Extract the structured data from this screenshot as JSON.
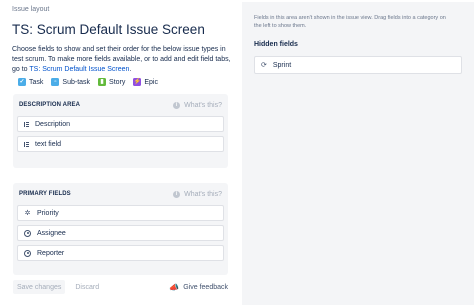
{
  "breadcrumb": "Issue layout",
  "title": "TS: Scrum Default Issue Screen",
  "description": {
    "text": "Choose fields to show and set their order for the below issue types in test scrum. To make more fields available, or to add and edit field tabs, go to ",
    "link": "TS: Scrum Default Issue Screen",
    "end": "."
  },
  "issue_types": [
    {
      "label": "Task",
      "icon": "task-icon",
      "color": "#4bade8",
      "glyph": "✓"
    },
    {
      "label": "Sub-task",
      "icon": "subtask-icon",
      "color": "#4bade8",
      "glyph": "▫"
    },
    {
      "label": "Story",
      "icon": "story-icon",
      "color": "#63ba3c",
      "glyph": "▮"
    },
    {
      "label": "Epic",
      "icon": "epic-icon",
      "color": "#904ee2",
      "glyph": "⚡"
    }
  ],
  "description_area": {
    "title": "DESCRIPTION AREA",
    "whats_this": "What's this?",
    "fields": [
      {
        "label": "Description",
        "icon": "lines-icon"
      },
      {
        "label": "text field",
        "icon": "lines-icon"
      }
    ]
  },
  "primary_fields": {
    "title": "PRIMARY FIELDS",
    "whats_this": "What's this?",
    "fields": [
      {
        "label": "Priority",
        "icon": "priority-icon"
      },
      {
        "label": "Assignee",
        "icon": "person-icon"
      },
      {
        "label": "Reporter",
        "icon": "person-icon"
      }
    ]
  },
  "right_panel": {
    "note": "Fields in this area aren't shown in the issue view. Drag fields into a category on the left to show them.",
    "hidden_title": "Hidden fields",
    "hidden_fields": [
      {
        "label": "Sprint",
        "icon": "sprint-icon"
      }
    ]
  },
  "footer": {
    "save": "Save changes",
    "discard": "Discard",
    "feedback": "Give feedback"
  }
}
